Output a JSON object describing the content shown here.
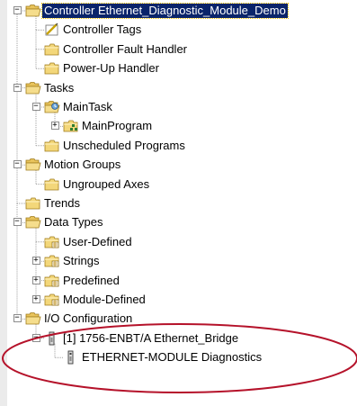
{
  "tree": {
    "nodes": [
      {
        "label": "Controller Ethernet_Diagnostic_Module_Demo",
        "icon": "folder-open-icon",
        "expander": "−",
        "selected": true
      },
      {
        "label": "Controller Tags",
        "icon": "tags-icon"
      },
      {
        "label": "Controller Fault Handler",
        "icon": "folder-icon"
      },
      {
        "label": "Power-Up Handler",
        "icon": "folder-icon"
      },
      {
        "label": "Tasks",
        "icon": "folder-open-icon",
        "expander": "−"
      },
      {
        "label": "MainTask",
        "icon": "task-icon",
        "expander": "−"
      },
      {
        "label": "MainProgram",
        "icon": "program-icon",
        "expander": "+"
      },
      {
        "label": "Unscheduled Programs",
        "icon": "folder-icon"
      },
      {
        "label": "Motion Groups",
        "icon": "folder-open-icon",
        "expander": "−"
      },
      {
        "label": "Ungrouped Axes",
        "icon": "folder-icon"
      },
      {
        "label": "Trends",
        "icon": "folder-icon"
      },
      {
        "label": "Data Types",
        "icon": "folder-open-icon",
        "expander": "−"
      },
      {
        "label": "User-Defined",
        "icon": "datatype-folder-icon"
      },
      {
        "label": "Strings",
        "icon": "datatype-folder-icon",
        "expander": "+"
      },
      {
        "label": "Predefined",
        "icon": "datatype-folder-icon",
        "expander": "+"
      },
      {
        "label": "Module-Defined",
        "icon": "datatype-folder-icon",
        "expander": "+"
      },
      {
        "label": "I/O Configuration",
        "icon": "folder-open-icon",
        "expander": "−"
      },
      {
        "label": "[1] 1756-ENBT/A Ethernet_Bridge",
        "icon": "module-icon",
        "expander": "−"
      },
      {
        "label": "ETHERNET-MODULE Diagnostics",
        "icon": "module-icon"
      }
    ]
  },
  "colors": {
    "selection": "#0a246a",
    "highlight_oval": "#b5122a",
    "folder": "#e9c46a"
  }
}
